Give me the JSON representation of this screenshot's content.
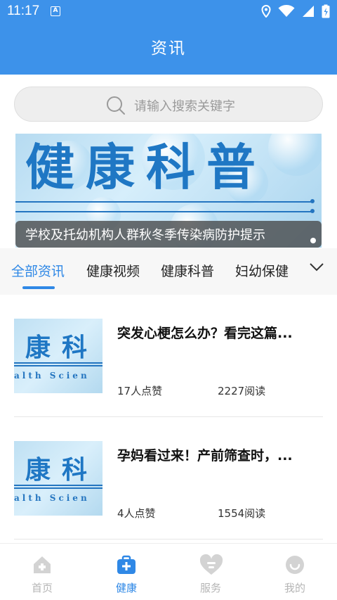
{
  "status": {
    "time": "11:17",
    "sim_badge": "A"
  },
  "header": {
    "title": "资讯"
  },
  "search": {
    "placeholder": "请输入搜索关键字"
  },
  "banner": {
    "big_text": "健康科普",
    "caption": "学校及托幼机构人群秋冬季传染病防护提示"
  },
  "tabs": [
    {
      "label": "全部资讯",
      "active": true
    },
    {
      "label": "健康视频",
      "active": false
    },
    {
      "label": "健康科普",
      "active": false
    },
    {
      "label": "妇幼保健",
      "active": false
    }
  ],
  "articles": [
    {
      "thumb_big": "康科",
      "thumb_small": "alth Scien",
      "title": "突发心梗怎么办？看完这篇...",
      "likes": "17人点赞",
      "reads": "2227阅读"
    },
    {
      "thumb_big": "康科",
      "thumb_small": "alth Scien",
      "title": "孕妈看过来！产前筛查时，...",
      "likes": "4人点赞",
      "reads": "1554阅读"
    }
  ],
  "nav": [
    {
      "label": "首页",
      "icon": "home-icon",
      "active": false
    },
    {
      "label": "健康",
      "icon": "medical-kit-icon",
      "active": true
    },
    {
      "label": "服务",
      "icon": "heart-service-icon",
      "active": false
    },
    {
      "label": "我的",
      "icon": "profile-icon",
      "active": false
    }
  ],
  "colors": {
    "primary": "#3d92ea",
    "accent": "#2f88e6",
    "inactive": "#b5b5b5"
  }
}
